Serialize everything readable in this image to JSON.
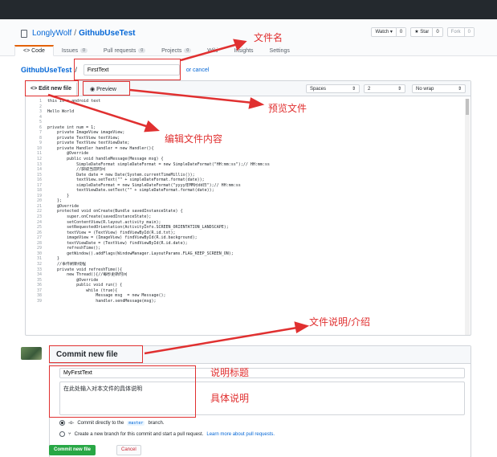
{
  "repo": {
    "owner": "LonglyWolf",
    "separator": "/",
    "name": "GithubUseTest",
    "actions": {
      "watch_label": "Watch ▾",
      "watch_count": "0",
      "star_label": "★ Star",
      "star_count": "0",
      "fork_label": "Fork",
      "fork_count": "0"
    },
    "tabs": [
      {
        "label": "<> Code",
        "count": ""
      },
      {
        "label": "Issues",
        "count": "0"
      },
      {
        "label": "Pull requests",
        "count": "0"
      },
      {
        "label": "Projects",
        "count": "0"
      },
      {
        "label": "Wiki",
        "count": ""
      },
      {
        "label": "Insights",
        "count": ""
      },
      {
        "label": "Settings",
        "count": ""
      }
    ]
  },
  "path": {
    "repo": "GithubUseTest",
    "slash": "/",
    "filename_value": "FirstText",
    "cancel_text": "or cancel"
  },
  "editor": {
    "edit_tab": "<> Edit new file",
    "preview_tab": "Preview",
    "indent_mode": "Spaces",
    "indent_size": "2",
    "wrap_mode": "No wrap",
    "lines": [
      "this is a android text",
      "",
      "Hello World",
      "",
      "",
      "private int num = 1;",
      "    private ImageView imageView;",
      "    private TextView textView;",
      "    private TextView textViewDate;",
      "    private Handler handler = new Handler(){",
      "        @Override",
      "        public void handleMessage(Message msg) {",
      "            SimpleDateFormat simpleDateFormat = new SimpleDateFormat(\"HH:mm:ss\");// HH:mm:ss",
      "            //获取当前时间",
      "            Date date = new Date(System.currentTimeMillis());",
      "            textView.setText(\"\" + simpleDateFormat.format(date));",
      "            simpleDateFormat = new SimpleDateFormat(\"yyyy年MM月dd日\");// HH:mm:ss",
      "            textViewDate.setText(\"\" + simpleDateFormat.format(date));",
      "        }",
      "    };",
      "    @Override",
      "    protected void onCreate(Bundle savedInstanceState) {",
      "        super.onCreate(savedInstanceState);",
      "        setContentView(R.layout.activity_main);",
      "        setRequestedOrientation(ActivityInfo.SCREEN_ORIENTATION_LANDSCAPE);",
      "        textView = (TextView) findViewById(R.id.txt);",
      "        imageView = (ImageView) findViewById(R.id.background);",
      "        textViewDate = (TextView) findViewById(R.id.date);",
      "        refreshTime();",
      "        getWindow().addFlags(WindowManager.LayoutParams.FLAG_KEEP_SCREEN_ON);",
      "    }",
      "    //事件刷新线程",
      "    private void refreshTime(){",
      "        new Thread(){//每秒更新时间",
      "            @Override",
      "            public void run() {",
      "                while (true){",
      "                    Message msg  = new Message();",
      "                    handler.sendMessage(msg);"
    ],
    "line_numbers": [
      "1",
      "2",
      "3",
      "4",
      "5",
      "6",
      "7",
      "8",
      "9",
      "10",
      "11",
      "12",
      "13",
      "14",
      "15",
      "16",
      "17",
      "18",
      "19",
      "20",
      "21",
      "22",
      "23",
      "24",
      "25",
      "26",
      "27",
      "28",
      "29",
      "30",
      "31",
      "32",
      "33",
      "34",
      "35",
      "36",
      "37",
      "38",
      "39"
    ]
  },
  "commit": {
    "heading": "Commit new file",
    "title_value": "MyFirstText",
    "description_value": "在此处输入对本文件的具体说明",
    "option_direct_prefix": "Commit directly to the",
    "option_direct_branch": "master",
    "option_direct_suffix": "branch.",
    "option_new_branch": "Create a new branch for this commit and start a pull request.",
    "option_learn_more": "Learn more about pull requests.",
    "commit_button": "Commit new file",
    "cancel_button": "Cancel"
  },
  "annotations": {
    "filename": "文件名",
    "preview": "预览文件",
    "edit_content": "编辑文件内容",
    "description": "文件说明/介绍",
    "title": "说明标题",
    "detail": "具体说明"
  },
  "colors": {
    "annotation": "#e03030",
    "link": "#0366d6",
    "commit_green": "#28a745",
    "topbar": "#24292e"
  }
}
